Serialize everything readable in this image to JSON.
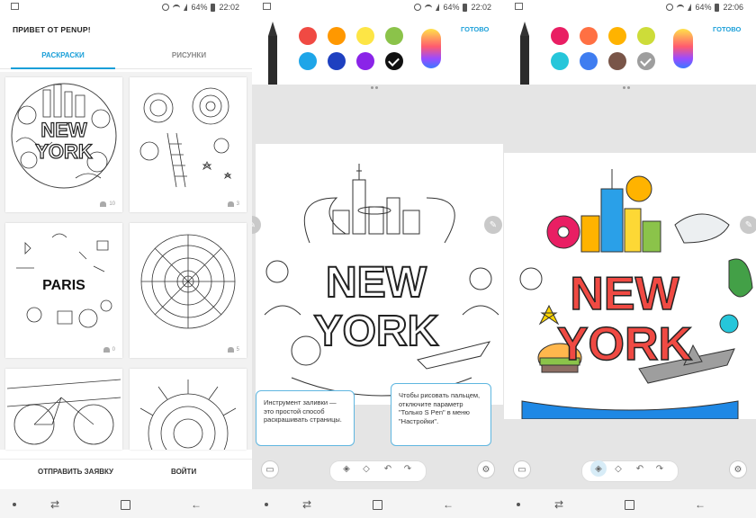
{
  "status": {
    "battery_p1": "64%",
    "time_p1": "22:02",
    "battery_p2": "64%",
    "time_p2": "22:02",
    "battery_p3": "64%",
    "time_p3": "22:06"
  },
  "home": {
    "greeting": "ПРИВЕТ ОТ PENUP!",
    "tabs": [
      {
        "label": "РАСКРАСКИ",
        "active": true
      },
      {
        "label": "РИСУНКИ",
        "active": false
      }
    ],
    "cards": [
      {
        "name": "new-york",
        "likes": "10",
        "art_text": [
          "NEW",
          "YORK"
        ]
      },
      {
        "name": "fantasy-swirls",
        "likes": "3"
      },
      {
        "name": "paris",
        "likes": "0",
        "art_text": [
          "PARIS"
        ]
      },
      {
        "name": "mandala",
        "likes": "5"
      },
      {
        "name": "bicycle",
        "likes": ""
      },
      {
        "name": "sunflower-mandala",
        "likes": ""
      }
    ],
    "bottom": {
      "send_request": "ОТПРАВИТЬ ЗАЯВКУ",
      "login": "ВОЙТИ"
    }
  },
  "editor1": {
    "done": "ГОТОВО",
    "colors": [
      "#f04a43",
      "#ff9800",
      "#fde545",
      "#8bc34a",
      "#1ea5e8",
      "#1e40c0",
      "#8a24e8",
      "#111111"
    ],
    "selected_index": 7,
    "art_text": [
      "NEW",
      "YORK"
    ],
    "tip_fill": "Инструмент заливки — это простой способ раскрашивать страницы.",
    "tip_finger": "Чтобы рисовать пальцем, отключите параметр \"Только S Pen\" в меню \"Настройки\"."
  },
  "editor2": {
    "done": "ГОТОВО",
    "colors": [
      "#e91e63",
      "#ff7043",
      "#ffb300",
      "#cddc39",
      "#26c6da",
      "#3f7df0",
      "#795548",
      "#9e9e9e"
    ],
    "selected_index": 7,
    "art_text": [
      "NEW",
      "YORK"
    ],
    "accent": "#f04a43"
  }
}
